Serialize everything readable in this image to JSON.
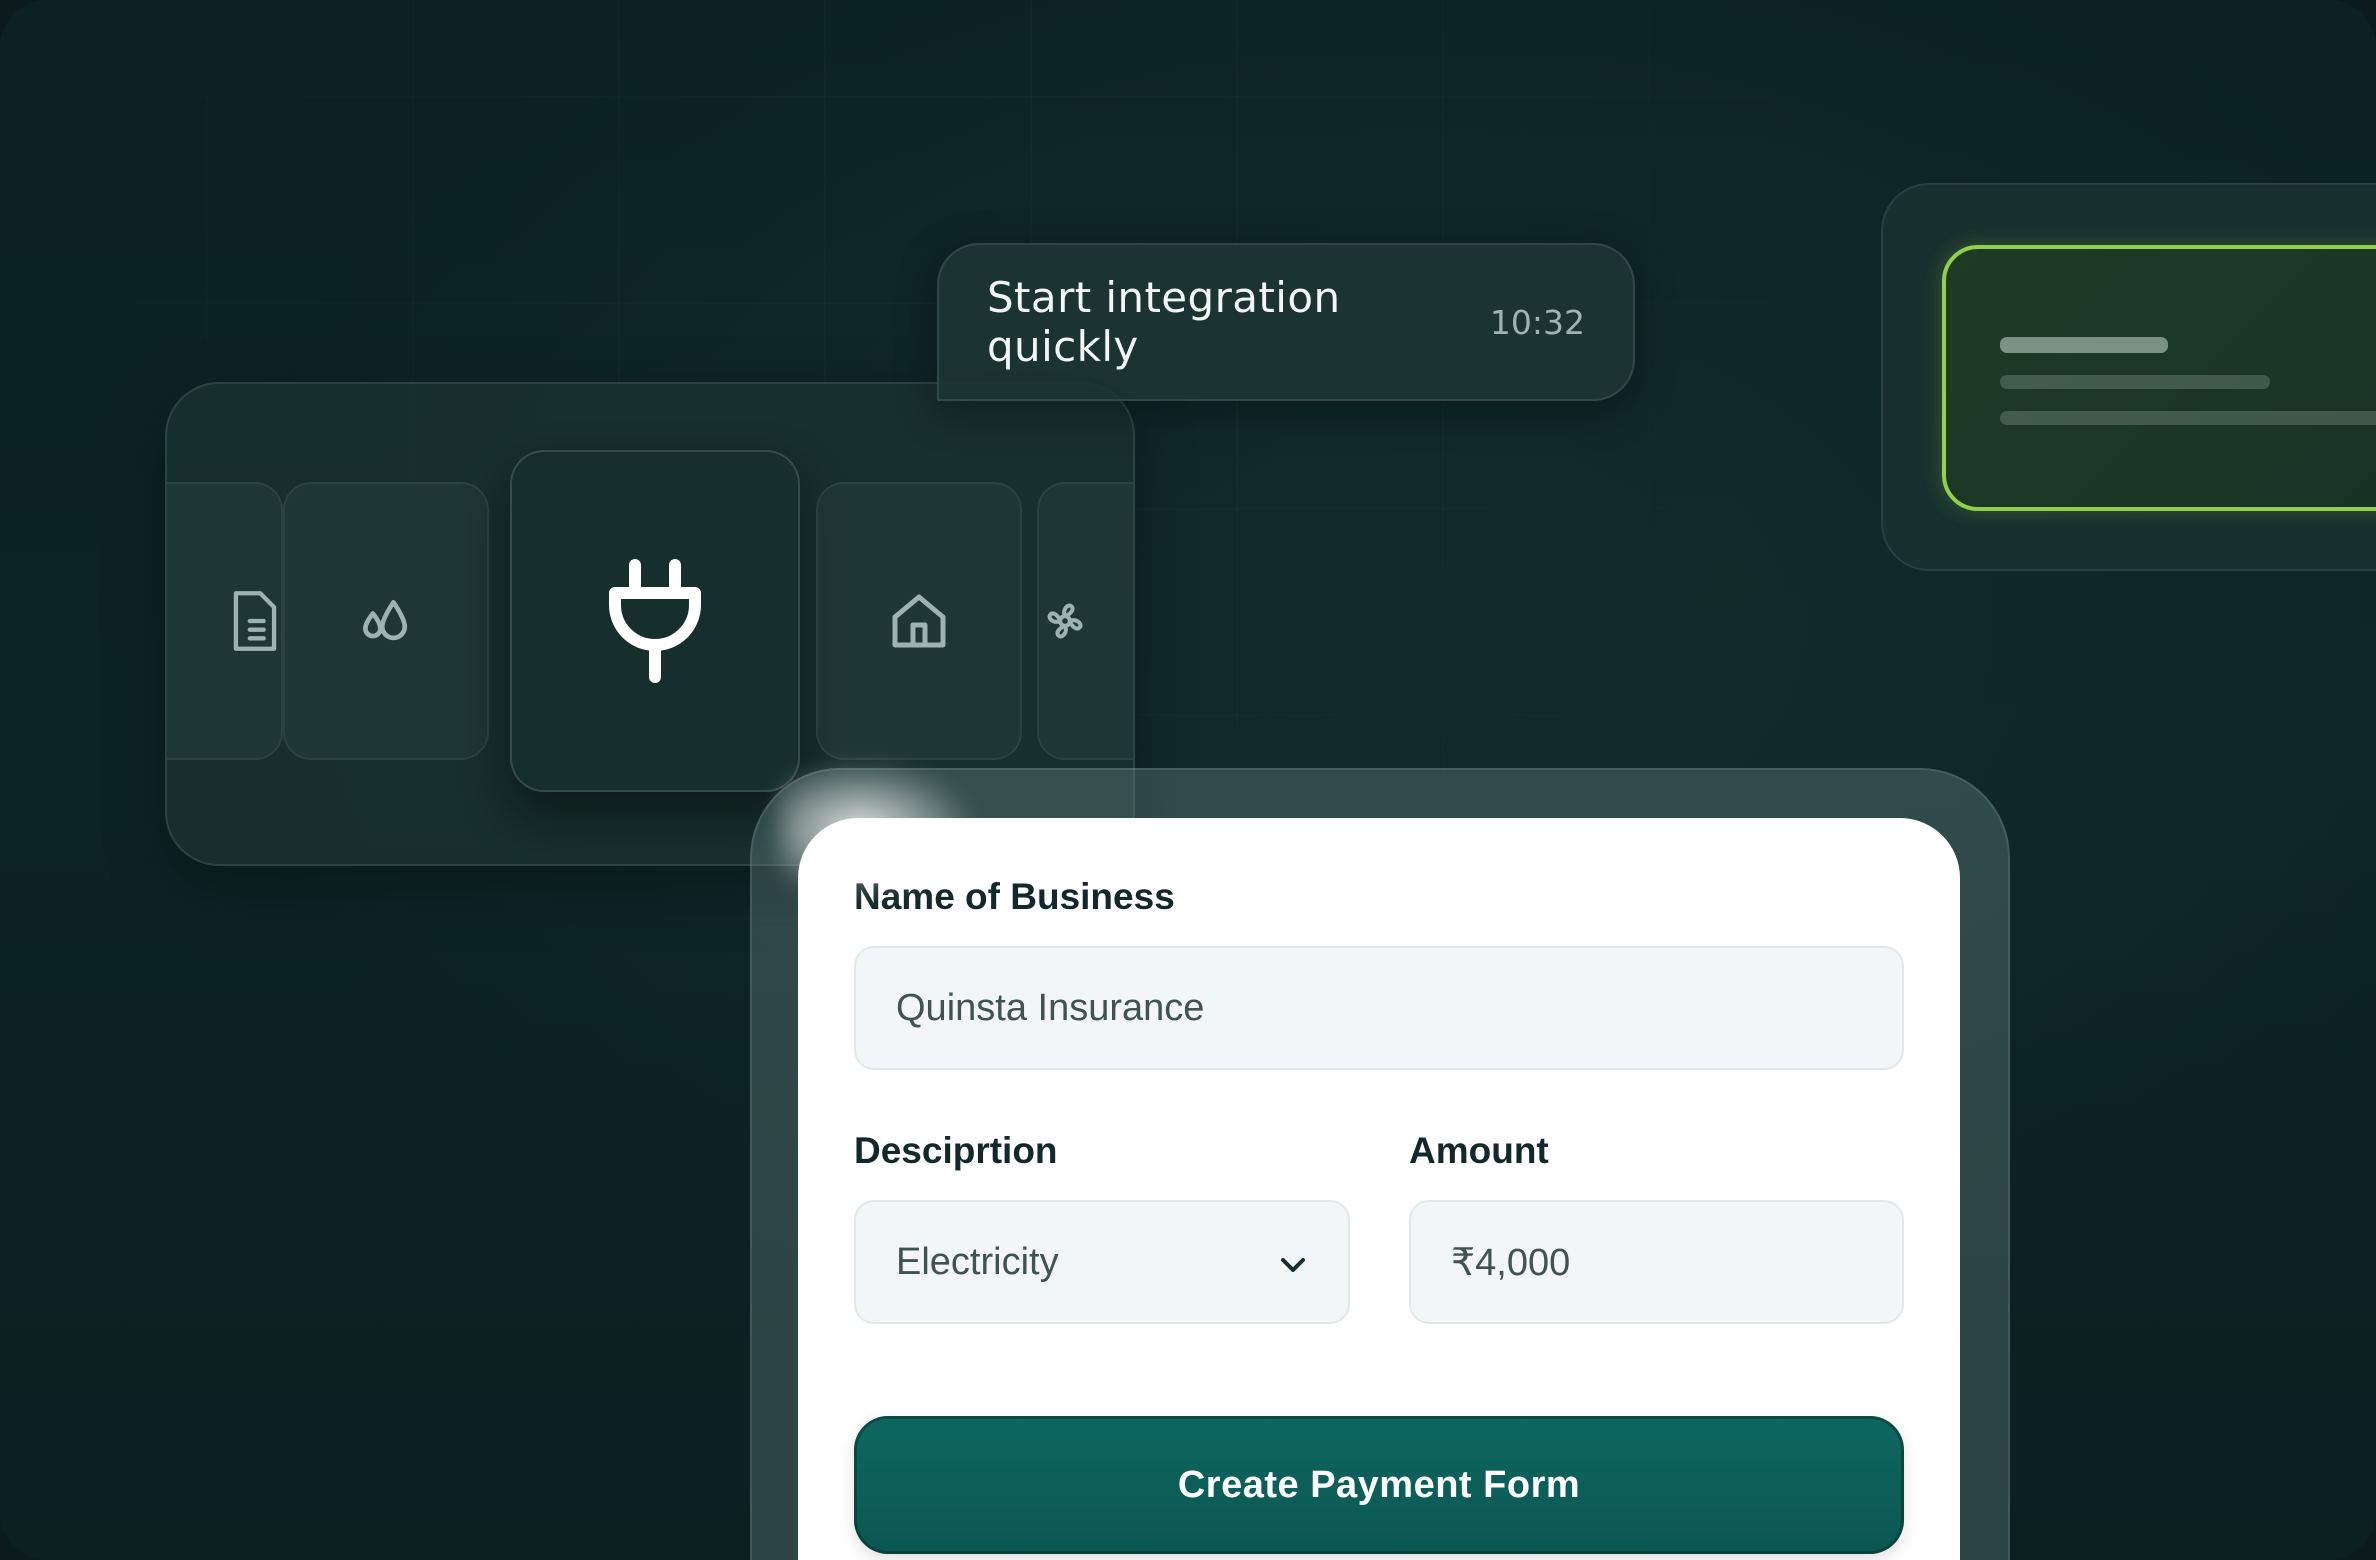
{
  "chat": {
    "message": "Start integration quickly",
    "time": "10:32"
  },
  "carousel": {
    "icons": [
      "document-icon",
      "water-drops-icon",
      "plug-icon",
      "home-icon",
      "flower-icon"
    ],
    "selected": "plug-icon"
  },
  "form": {
    "business_label": "Name of Business",
    "business_value": "Quinsta Insurance",
    "description_label": "Desciprtion",
    "description_value": "Electricity",
    "amount_label": "Amount",
    "amount_value": "₹4,000",
    "submit_label": "Create Payment Form"
  },
  "colors": {
    "background": "#0c2222",
    "accent_green": "#8fd14b",
    "button_teal": "#0e6660"
  }
}
